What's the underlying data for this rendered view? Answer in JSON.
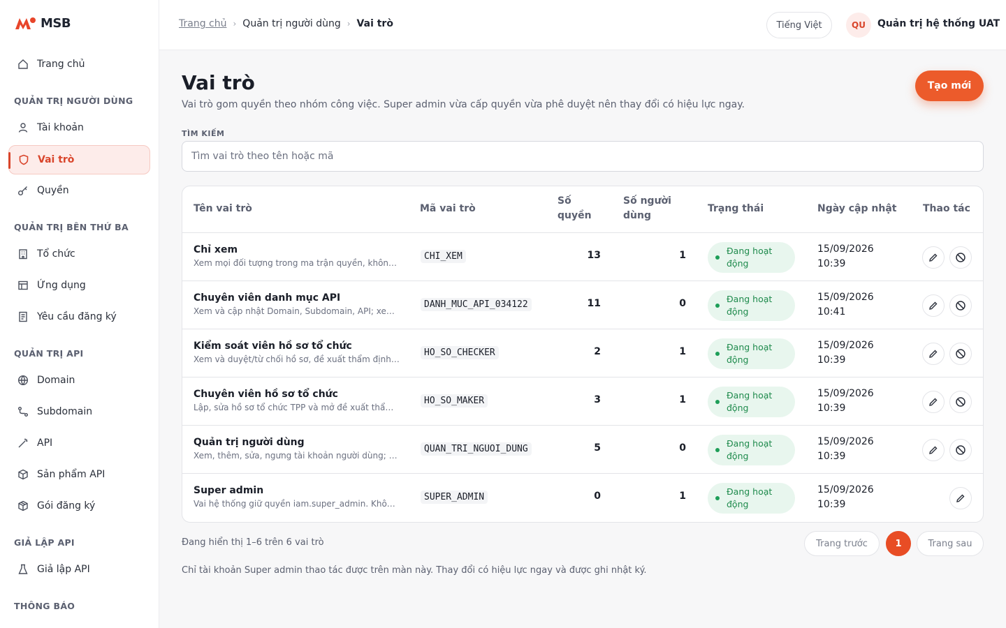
{
  "brand": {
    "name": "MSB",
    "accent": "#e8452a"
  },
  "sidebar": {
    "home": {
      "label": "Trang chủ",
      "icon": "home-icon"
    },
    "sections": [
      {
        "title": "QUẢN TRỊ NGƯỜI DÙNG"
      },
      {
        "title": "QUẢN TRỊ BÊN THỨ BA"
      },
      {
        "title": "QUẢN TRỊ API"
      },
      {
        "title": "GIẢ LẬP API"
      },
      {
        "title": "THÔNG BÁO"
      }
    ],
    "items": [
      {
        "label": "Tài khoản",
        "icon": "user-icon"
      },
      {
        "label": "Vai trò",
        "icon": "shield-icon"
      },
      {
        "label": "Quyền",
        "icon": "key-icon"
      },
      {
        "label": "Tổ chức",
        "icon": "building-icon"
      },
      {
        "label": "Ứng dụng",
        "icon": "app-window-icon"
      },
      {
        "label": "Yêu cầu đăng ký",
        "icon": "document-icon"
      },
      {
        "label": "Domain",
        "icon": "globe-icon"
      },
      {
        "label": "Subdomain",
        "icon": "route-icon"
      },
      {
        "label": "API",
        "icon": "wand-icon"
      },
      {
        "label": "Sản phẩm API",
        "icon": "box-icon"
      },
      {
        "label": "Gói đăng ký",
        "icon": "package-icon"
      },
      {
        "label": "Giả lập API",
        "icon": "flask-icon"
      }
    ]
  },
  "header": {
    "breadcrumb": {
      "home": "Trang chủ",
      "parent": "Quản trị người dùng",
      "current": "Vai trò"
    },
    "language": "Tiếng Việt",
    "user_initials": "QU",
    "user_name": "Quản trị hệ thống UAT"
  },
  "page": {
    "title": "Vai trò",
    "description": "Vai trò gom quyền theo nhóm công việc. Super admin vừa cấp quyền vừa phê duyệt nên thay đổi có hiệu lực ngay.",
    "create_label": "Tạo mới",
    "search_label": "TÌM KIẾM",
    "search_placeholder": "Tìm vai trò theo tên hoặc mã"
  },
  "table": {
    "columns": {
      "name": "Tên vai trò",
      "code": "Mã vai trò",
      "perm_line1": "Số",
      "perm_line2": "quyền",
      "users_line1": "Số người",
      "users_line2": "dùng",
      "status": "Trạng thái",
      "updated": "Ngày cập nhật",
      "actions": "Thao tác"
    },
    "rows": [
      {
        "name": "Chỉ xem",
        "desc": "Xem mọi đối tượng trong ma trận quyền, không s...",
        "code": "CHI_XEM",
        "perms": "13",
        "users": "1",
        "status_line1": "Đang hoạt",
        "status_line2": "động",
        "date": "15/09/2026",
        "time": "10:39"
      },
      {
        "name": "Chuyên viên danh mục API",
        "desc": "Xem và cập nhật Domain, Subdomain, API; xem ...",
        "code": "DANH_MUC_API_034122",
        "perms": "11",
        "users": "0",
        "status_line1": "Đang hoạt",
        "status_line2": "động",
        "date": "15/09/2026",
        "time": "10:41"
      },
      {
        "name": "Kiểm soát viên hồ sơ tổ chức",
        "desc": "Xem và duyệt/từ chối hồ sơ, đề xuất thẩm định c...",
        "code": "HO_SO_CHECKER",
        "perms": "2",
        "users": "1",
        "status_line1": "Đang hoạt",
        "status_line2": "động",
        "date": "15/09/2026",
        "time": "10:39"
      },
      {
        "name": "Chuyên viên hồ sơ tổ chức",
        "desc": "Lập, sửa hồ sơ tổ chức TPP và mở đề xuất thẩm ...",
        "code": "HO_SO_MAKER",
        "perms": "3",
        "users": "1",
        "status_line1": "Đang hoạt",
        "status_line2": "động",
        "date": "15/09/2026",
        "time": "10:39"
      },
      {
        "name": "Quản trị người dùng",
        "desc": "Xem, thêm, sửa, ngưng tài khoản người dùng; xe...",
        "code": "QUAN_TRI_NGUOI_DUNG",
        "perms": "5",
        "users": "0",
        "status_line1": "Đang hoạt",
        "status_line2": "động",
        "date": "15/09/2026",
        "time": "10:39"
      },
      {
        "name": "Super admin",
        "desc": "Vai hệ thống giữ quyền iam.super_admin. Không...",
        "code": "SUPER_ADMIN",
        "perms": "0",
        "users": "1",
        "status_line1": "Đang hoạt",
        "status_line2": "động",
        "date": "15/09/2026",
        "time": "10:39"
      }
    ]
  },
  "pagination": {
    "summary": "Đang hiển thị 1–6 trên 6 vai trò",
    "prev": "Trang trước",
    "current": "1",
    "next": "Trang sau"
  },
  "footnote": "Chỉ tài khoản Super admin thao tác được trên màn này. Thay đổi có hiệu lực ngay và được ghi nhật ký.",
  "colors": {
    "primary": "#ec5b2b",
    "active_bg": "#fdecea",
    "status_bg": "#e8f6ee",
    "status_fg": "#1e8a4c"
  }
}
